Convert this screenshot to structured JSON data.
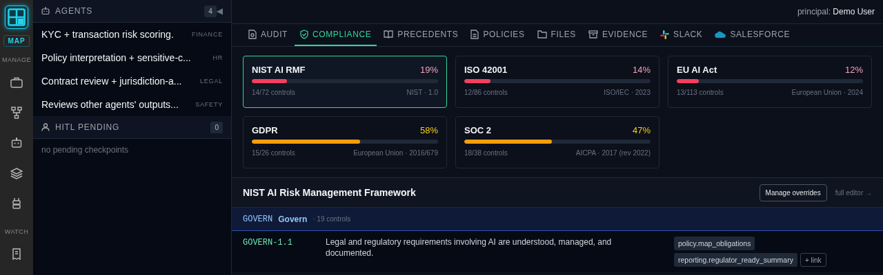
{
  "rail": {
    "badge": "MAP",
    "sections": [
      {
        "label": "MANAGE",
        "icons": [
          {
            "kind": "briefcase"
          },
          {
            "kind": "hierarchy"
          },
          {
            "kind": "robot"
          },
          {
            "kind": "layers"
          },
          {
            "kind": "plug"
          }
        ]
      },
      {
        "label": "WATCH",
        "icons": [
          {
            "kind": "receipt"
          }
        ]
      }
    ]
  },
  "agents": {
    "title": "AGENTS",
    "count": "4",
    "collapse": "◀",
    "items": [
      {
        "text": "KYC + transaction risk scoring.",
        "tag": "FINANCE"
      },
      {
        "text": "Policy interpretation + sensitive-c...",
        "tag": "HR"
      },
      {
        "text": "Contract review + jurisdiction-a...",
        "tag": "LEGAL"
      },
      {
        "text": "Reviews other agents' outputs...",
        "tag": "SAFETY"
      }
    ]
  },
  "hitl": {
    "title": "HITL PENDING",
    "count": "0",
    "empty": "no pending checkpoints"
  },
  "principal": {
    "label": "principal:",
    "name": "Demo User"
  },
  "tabs": [
    {
      "label": "AUDIT",
      "kind": "audit",
      "selected": false
    },
    {
      "label": "COMPLIANCE",
      "kind": "compliance",
      "selected": true
    },
    {
      "label": "PRECEDENTS",
      "kind": "precedents",
      "selected": false
    },
    {
      "label": "POLICIES",
      "kind": "policies",
      "selected": false
    },
    {
      "label": "FILES",
      "kind": "files",
      "selected": false
    },
    {
      "label": "EVIDENCE",
      "kind": "evidence",
      "selected": false
    },
    {
      "label": "SLACK",
      "kind": "slack",
      "selected": false
    },
    {
      "label": "SALESFORCE",
      "kind": "salesforce",
      "selected": false
    }
  ],
  "frameworks": [
    {
      "name": "NIST AI RMF",
      "percent": "19%",
      "level": 0.19,
      "controls": "14/72 controls",
      "source": "NIST · 1.0",
      "selected": true
    },
    {
      "name": "ISO 42001",
      "percent": "14%",
      "level": 0.14,
      "controls": "12/86 controls",
      "source": "ISO/IEC · 2023",
      "selected": false
    },
    {
      "name": "EU AI Act",
      "percent": "12%",
      "level": 0.12,
      "controls": "13/113 controls",
      "source": "European Union · 2024",
      "selected": false
    },
    {
      "name": "GDPR",
      "percent": "58%",
      "level": 0.58,
      "controls": "15/26 controls",
      "source": "European Union · 2016/679",
      "selected": false
    },
    {
      "name": "SOC 2",
      "percent": "47%",
      "level": 0.47,
      "controls": "18/38 controls",
      "source": "AICPA · 2017 (rev 2022)",
      "selected": false
    }
  ],
  "detail": {
    "title": "NIST AI Risk Management Framework",
    "manage": "Manage overrides",
    "editor": "full editor →",
    "group": {
      "code": "GOVERN",
      "name": "Govern",
      "count": "· 19 controls"
    },
    "controls": [
      {
        "id": "GOVERN-1.1",
        "text": "Legal and regulatory requirements involving AI are understood, managed, and documented.",
        "links": [
          "policy.map_obligations",
          "reporting.regulator_ready_summary"
        ],
        "add": "+ link"
      }
    ]
  }
}
